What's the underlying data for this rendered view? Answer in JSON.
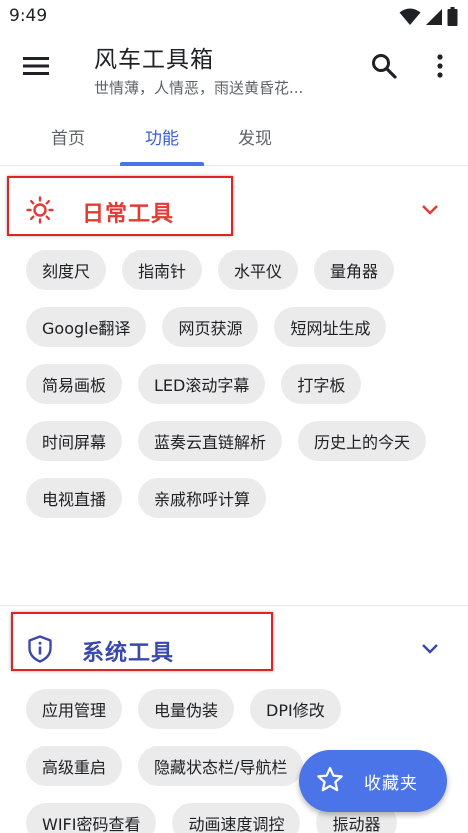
{
  "status_bar": {
    "time": "9:49"
  },
  "app_bar": {
    "title": "风车工具箱",
    "subtitle": "世情薄，人情恶，雨送黄昏花..."
  },
  "tabs": [
    {
      "label": "首页"
    },
    {
      "label": "功能"
    },
    {
      "label": "发现"
    }
  ],
  "active_tab": "功能",
  "sections": [
    {
      "title": "日常工具",
      "icon": "sun-icon",
      "color": "#e53935",
      "items": [
        "刻度尺",
        "指南针",
        "水平仪",
        "量角器",
        "Google翻译",
        "网页获源",
        "短网址生成",
        "简易画板",
        "LED滚动字幕",
        "打字板",
        "时间屏幕",
        "蓝奏云直链解析",
        "历史上的今天",
        "电视直播",
        "亲戚称呼计算"
      ]
    },
    {
      "title": "系统工具",
      "icon": "shield-info-icon",
      "color": "#3949ab",
      "items": [
        "应用管理",
        "电量伪装",
        "DPI修改",
        "高级重启",
        "隐藏状态栏/导航栏",
        "WIFI密码查看",
        "动画速度调控",
        "振动器"
      ]
    }
  ],
  "fab": {
    "label": "收藏夹",
    "icon": "star-icon"
  },
  "colors": {
    "accent": "#4a74e8",
    "chip_bg": "#ebebeb",
    "annotation_box": "#e02323"
  }
}
